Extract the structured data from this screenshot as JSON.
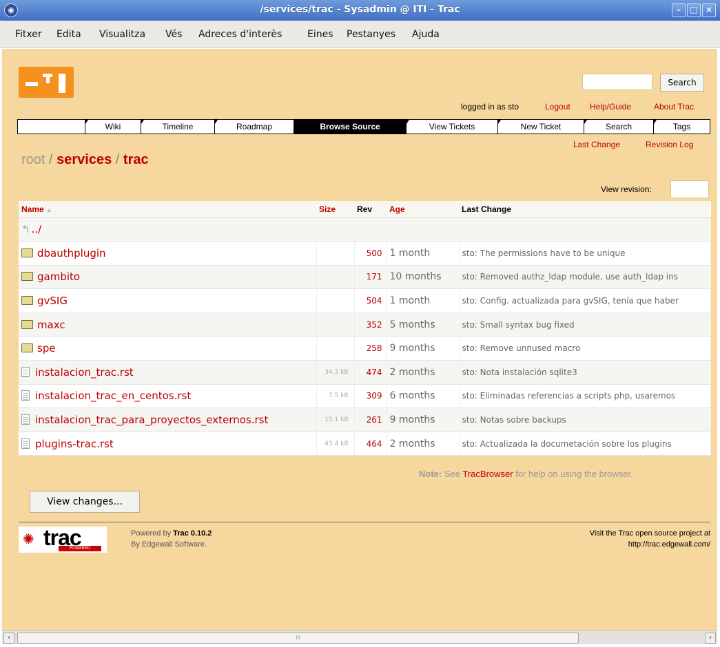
{
  "window": {
    "title": "/services/trac - Sysadmin @ ITI - Trac"
  },
  "menubar": [
    "Fitxer",
    "Edita",
    "Visualitza",
    "Vés",
    "Adreces d'interès",
    "Eines",
    "Pestanyes",
    "Ajuda"
  ],
  "search": {
    "button": "Search"
  },
  "metanav": {
    "logged_in": "logged in as sto",
    "logout": "Logout",
    "help": "Help/Guide",
    "about": "About Trac"
  },
  "mainnav": [
    "Wiki",
    "Timeline",
    "Roadmap",
    "Browse Source",
    "View Tickets",
    "New Ticket",
    "Search",
    "Tags"
  ],
  "mainnav_active": "Browse Source",
  "ctxnav": {
    "last_change": "Last Change",
    "revision_log": "Revision Log"
  },
  "path": {
    "root": "root",
    "sep": "/",
    "segments": [
      "services",
      "trac"
    ]
  },
  "view_revision": {
    "label": "View revision:"
  },
  "table": {
    "headers": {
      "name": "Name",
      "sort_arrow": "▲",
      "size": "Size",
      "rev": "Rev",
      "age": "Age",
      "change": "Last Change"
    },
    "parent": "../",
    "rows": [
      {
        "type": "dir",
        "name": "dbauthplugin",
        "size": "",
        "rev": "500",
        "age": "1 month",
        "change": "sto: The permissions have to be unique"
      },
      {
        "type": "dir",
        "name": "gambito",
        "size": "",
        "rev": "171",
        "age": "10 months",
        "change": "sto: Removed authz_ldap module, use auth_ldap ins"
      },
      {
        "type": "dir",
        "name": "gvSIG",
        "size": "",
        "rev": "504",
        "age": "1 month",
        "change": "sto: Config. actualizada para gvSIG, tenía que haber"
      },
      {
        "type": "dir",
        "name": "maxc",
        "size": "",
        "rev": "352",
        "age": "5 months",
        "change": "sto: Small syntax bug fixed"
      },
      {
        "type": "dir",
        "name": "spe",
        "size": "",
        "rev": "258",
        "age": "9 months",
        "change": "sto: Remove unnused macro"
      },
      {
        "type": "file",
        "name": "instalacion_trac.rst",
        "size": "34.3 kB",
        "rev": "474",
        "age": "2 months",
        "change": "sto: Nota instalación sqlite3"
      },
      {
        "type": "file",
        "name": "instalacion_trac_en_centos.rst",
        "size": "7.5 kB",
        "rev": "309",
        "age": "6 months",
        "change": "sto: Eliminadas referencias a scripts php, usaremos"
      },
      {
        "type": "file",
        "name": "instalacion_trac_para_proyectos_externos.rst",
        "size": "15.1 kB",
        "rev": "261",
        "age": "9 months",
        "change": "sto: Notas sobre backups"
      },
      {
        "type": "file",
        "name": "plugins-trac.rst",
        "size": "43.4 kB",
        "rev": "464",
        "age": "2 months",
        "change": "sto: Actualizada la documetación sobre los plugins"
      }
    ]
  },
  "note": {
    "label": "Note:",
    "pre": "See",
    "link": "TracBrowser",
    "post": "for help on using the browser."
  },
  "view_changes": "View changes...",
  "footer": {
    "logo_word": "trac",
    "logo_badge": "POWERED",
    "powered_pre": "Powered by",
    "powered_name": "Trac 0.10.2",
    "by": "By Edgewall Software.",
    "visit": "Visit the Trac open source project at",
    "url": "http://trac.edgewall.com/"
  },
  "scrollbar": {
    "thumb_grip": "III"
  }
}
